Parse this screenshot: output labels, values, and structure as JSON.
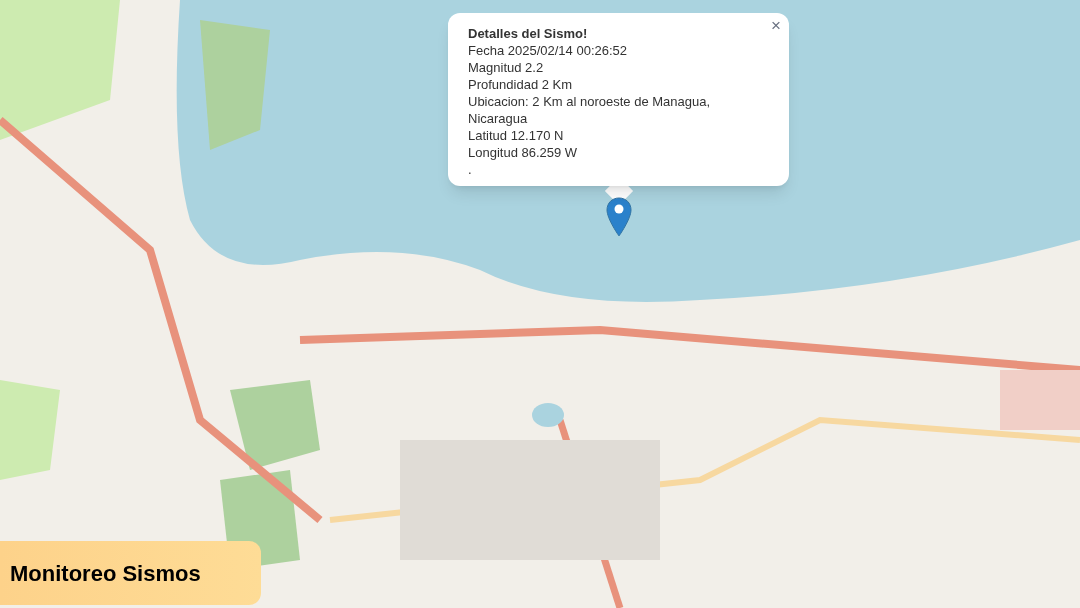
{
  "popup": {
    "close": "×",
    "title": "Detalles del Sismo!",
    "lines": [
      "Fecha 2025/02/14 00:26:52",
      "Magnitud 2.2",
      "Profundidad 2 Km",
      "Ubicacion: 2 Km al noroeste de Managua, Nicaragua",
      "Latitud 12.170 N",
      "Longitud 86.259 W",
      "."
    ]
  },
  "banner": {
    "title": "Monitoreo Sismos"
  }
}
